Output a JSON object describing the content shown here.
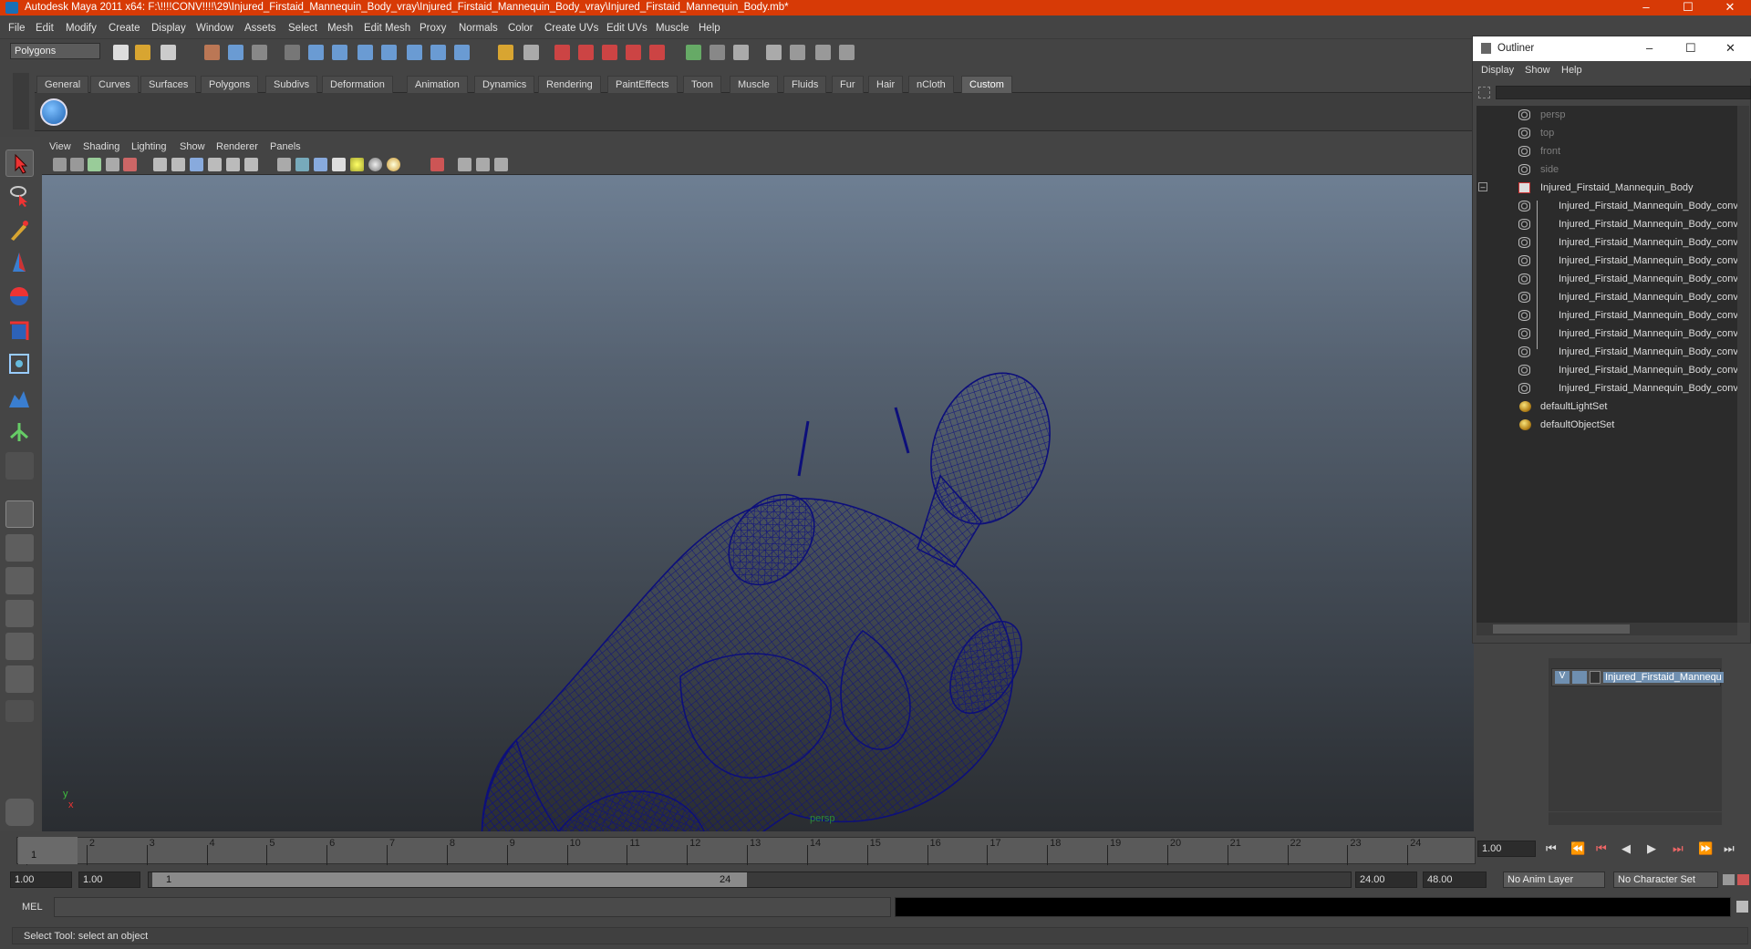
{
  "window": {
    "title": "Autodesk Maya 2011 x64: F:\\!!!!CONV!!!!\\29\\Injured_Firstaid_Mannequin_Body_vray\\Injured_Firstaid_Mannequin_Body_vray\\Injured_Firstaid_Mannequin_Body.mb*",
    "minimize": "–",
    "maximize": "☐",
    "close": "✕"
  },
  "menu": [
    "File",
    "Edit",
    "Modify",
    "Create",
    "Display",
    "Window",
    "Assets",
    "Select",
    "Mesh",
    "Edit Mesh",
    "Proxy",
    "Normals",
    "Color",
    "Create UVs",
    "Edit UVs",
    "Muscle",
    "Help"
  ],
  "mode_selector": "Polygons",
  "shelf_tabs": [
    "General",
    "Curves",
    "Surfaces",
    "Polygons",
    "Subdivs",
    "Deformation",
    "Animation",
    "Dynamics",
    "Rendering",
    "PaintEffects",
    "Toon",
    "Muscle",
    "Fluids",
    "Fur",
    "Hair",
    "nCloth",
    "Custom"
  ],
  "active_shelf_tab": "Custom",
  "viewport": {
    "menu": [
      "View",
      "Shading",
      "Lighting",
      "Show",
      "Renderer",
      "Panels"
    ],
    "camera_label": "persp",
    "axis_y": "y",
    "axis_x": "x"
  },
  "outliner": {
    "title": "Outliner",
    "menu": [
      "Display",
      "Show",
      "Help"
    ],
    "cameras": [
      "persp",
      "top",
      "front",
      "side"
    ],
    "root": "Injured_Firstaid_Mannequin_Body",
    "children": [
      "Injured_Firstaid_Mannequin_Body_conv",
      "Injured_Firstaid_Mannequin_Body_conv",
      "Injured_Firstaid_Mannequin_Body_conv",
      "Injured_Firstaid_Mannequin_Body_conv",
      "Injured_Firstaid_Mannequin_Body_conv",
      "Injured_Firstaid_Mannequin_Body_conv",
      "Injured_Firstaid_Mannequin_Body_conv",
      "Injured_Firstaid_Mannequin_Body_conv",
      "Injured_Firstaid_Mannequin_Body_conv",
      "Injured_Firstaid_Mannequin_Body_conv",
      "Injured_Firstaid_Mannequin_Body_conv"
    ],
    "sets": [
      "defaultLightSet",
      "defaultObjectSet"
    ],
    "collapse_sign": "–"
  },
  "layer": {
    "visible": "V",
    "name": "Injured_Firstaid_Mannequ"
  },
  "timeline": {
    "ticks": [
      "1",
      "2",
      "3",
      "4",
      "5",
      "6",
      "7",
      "8",
      "9",
      "10",
      "11",
      "12",
      "13",
      "14",
      "15",
      "16",
      "17",
      "18",
      "19",
      "20",
      "21",
      "22",
      "23",
      "24"
    ],
    "current_frame_marker": "1",
    "current_time": "1.00"
  },
  "range": {
    "start_time": "1.00",
    "start_playback": "1.00",
    "slider_start": "1",
    "slider_end": "24",
    "end_playback": "24.00",
    "end_time": "48.00",
    "anim_layer": "No Anim Layer",
    "character_set": "No Character Set"
  },
  "command_line": {
    "label": "MEL"
  },
  "help_line": "Select Tool: select an object",
  "colors": {
    "title_bar": "#d73a06",
    "wireframe": "#0d0f7a",
    "active_tab": "#5e5e5e"
  }
}
